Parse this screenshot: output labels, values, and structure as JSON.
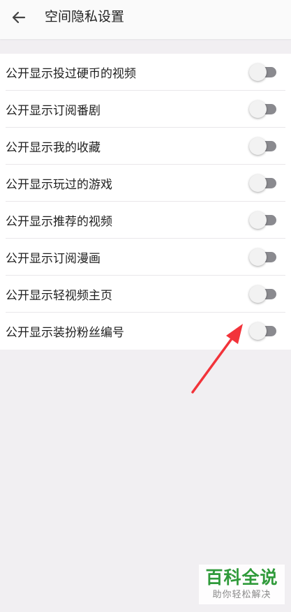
{
  "header": {
    "back_icon": "arrow-left-icon",
    "title": "空间隐私设置"
  },
  "settings": {
    "items": [
      {
        "label": "公开显示投过硬币的视频",
        "enabled": false
      },
      {
        "label": "公开显示订阅番剧",
        "enabled": false
      },
      {
        "label": "公开显示我的收藏",
        "enabled": false
      },
      {
        "label": "公开显示玩过的游戏",
        "enabled": false
      },
      {
        "label": "公开显示推荐的视频",
        "enabled": false
      },
      {
        "label": "公开显示订阅漫画",
        "enabled": false
      },
      {
        "label": "公开显示轻视频主页",
        "enabled": false
      },
      {
        "label": "公开显示装扮粉丝编号",
        "enabled": false
      }
    ]
  },
  "watermark": {
    "main": "百科全说",
    "sub": "助你轻松解决"
  },
  "colors": {
    "page_bg": "#f1eff2",
    "toggle_off_track": "#8a8a8f",
    "annotation_arrow": "#f2333a",
    "watermark_green": "#2f9a3a"
  }
}
